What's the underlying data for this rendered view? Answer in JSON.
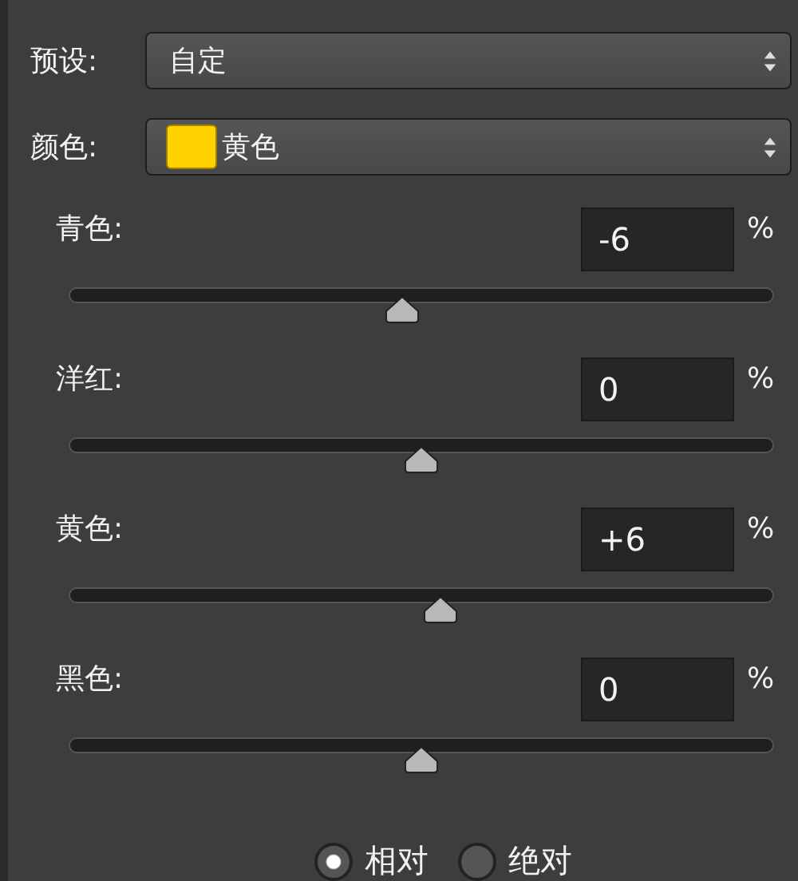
{
  "preset": {
    "label": "预设:",
    "value": "自定"
  },
  "color": {
    "label": "颜色:",
    "value": "黄色",
    "color": "#ffd200"
  },
  "sliders": [
    {
      "name": "青色:",
      "value": "-6",
      "unit": "%",
      "level": 0.473
    },
    {
      "name": "洋红:",
      "value": "0",
      "unit": "%",
      "level": 0.5
    },
    {
      "name": "黄色:",
      "value": "+6",
      "unit": "%",
      "level": 0.527
    },
    {
      "name": "黑色:",
      "value": "0",
      "unit": "%",
      "level": 0.5
    }
  ],
  "method": [
    {
      "label": "相对",
      "selected": true
    },
    {
      "label": "绝对",
      "selected": false
    }
  ]
}
